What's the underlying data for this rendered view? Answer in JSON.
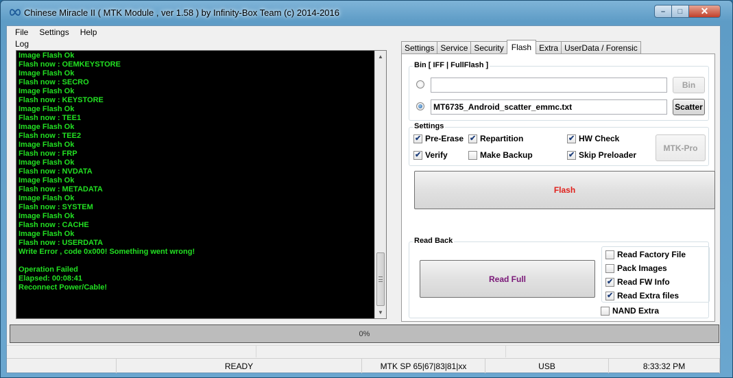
{
  "window": {
    "title": "Chinese Miracle II ( MTK Module , ver 1.58 ) by Infinity-Box Team (c) 2014-2016",
    "minimize": "–",
    "maximize": "□",
    "close": "✕"
  },
  "menu": [
    "File",
    "Settings",
    "Help"
  ],
  "log": {
    "label": "Log",
    "lines": [
      "Image Flash Ok",
      "Flash now : OEMKEYSTORE",
      "Image Flash Ok",
      "Flash now : SECRO",
      "Image Flash Ok",
      "Flash now : KEYSTORE",
      "Image Flash Ok",
      "Flash now : TEE1",
      "Image Flash Ok",
      "Flash now : TEE2",
      "Image Flash Ok",
      "Flash now : FRP",
      "Image Flash Ok",
      "Flash now : NVDATA",
      "Image Flash Ok",
      "Flash now : METADATA",
      "Image Flash Ok",
      "Flash now : SYSTEM",
      "Image Flash Ok",
      "Flash now : CACHE",
      "Image Flash Ok",
      "Flash now : USERDATA",
      "Write Error , code 0x000! Something went wrong!",
      "",
      "Operation Failed",
      "Elapsed: 00:08:41",
      "Reconnect Power/Cable!"
    ]
  },
  "tabs": [
    "Settings",
    "Service",
    "Security",
    "Flash",
    "Extra",
    "UserData / Forensic"
  ],
  "active_tab": "Flash",
  "flash": {
    "bin_group_label": "Bin  [ IFF | FullFlash ]",
    "bin_path_value": "",
    "bin_button": "Bin",
    "scatter_value": "MT6735_Android_scatter_emmc.txt",
    "scatter_button": "Scatter",
    "settings_label": "Settings",
    "checkboxes": {
      "pre_erase": "Pre-Erase",
      "repartition": "Repartition",
      "hw_check": "HW Check",
      "verify": "Verify",
      "make_backup": "Make Backup",
      "skip_preloader": "Skip Preloader"
    },
    "mtk_pro_button": "MTK-Pro",
    "flash_button": "Flash",
    "flash_button_color": "#e0201b",
    "readback_label": "Read Back",
    "read_full_button": "Read Full",
    "read_full_color": "#7a1878",
    "readback_options": {
      "read_factory_file": "Read Factory File",
      "pack_images": "Pack Images",
      "read_fw_info": "Read FW Info",
      "read_extra_files": "Read Extra files"
    },
    "nand_extra": "NAND Extra"
  },
  "progress": {
    "text": "0%",
    "value": 0
  },
  "status": {
    "state": "READY",
    "chip": "MTK SP 65|67|83|81|xx",
    "connection": "USB",
    "time": "8:33:32 PM"
  }
}
